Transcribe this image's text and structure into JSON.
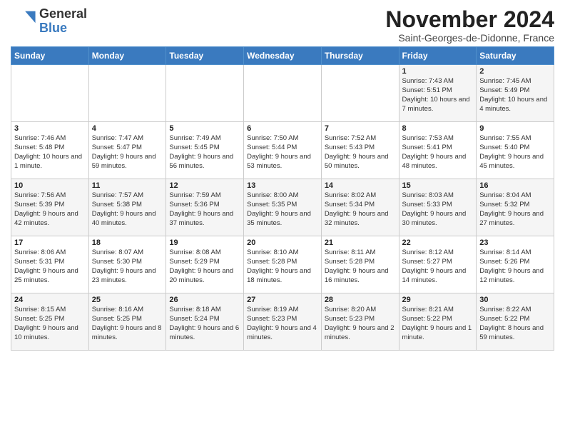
{
  "logo": {
    "line1": "General",
    "line2": "Blue"
  },
  "title": "November 2024",
  "subtitle": "Saint-Georges-de-Didonne, France",
  "weekdays": [
    "Sunday",
    "Monday",
    "Tuesday",
    "Wednesday",
    "Thursday",
    "Friday",
    "Saturday"
  ],
  "weeks": [
    [
      {
        "day": "",
        "info": ""
      },
      {
        "day": "",
        "info": ""
      },
      {
        "day": "",
        "info": ""
      },
      {
        "day": "",
        "info": ""
      },
      {
        "day": "",
        "info": ""
      },
      {
        "day": "1",
        "info": "Sunrise: 7:43 AM\nSunset: 5:51 PM\nDaylight: 10 hours and 7 minutes."
      },
      {
        "day": "2",
        "info": "Sunrise: 7:45 AM\nSunset: 5:49 PM\nDaylight: 10 hours and 4 minutes."
      }
    ],
    [
      {
        "day": "3",
        "info": "Sunrise: 7:46 AM\nSunset: 5:48 PM\nDaylight: 10 hours and 1 minute."
      },
      {
        "day": "4",
        "info": "Sunrise: 7:47 AM\nSunset: 5:47 PM\nDaylight: 9 hours and 59 minutes."
      },
      {
        "day": "5",
        "info": "Sunrise: 7:49 AM\nSunset: 5:45 PM\nDaylight: 9 hours and 56 minutes."
      },
      {
        "day": "6",
        "info": "Sunrise: 7:50 AM\nSunset: 5:44 PM\nDaylight: 9 hours and 53 minutes."
      },
      {
        "day": "7",
        "info": "Sunrise: 7:52 AM\nSunset: 5:43 PM\nDaylight: 9 hours and 50 minutes."
      },
      {
        "day": "8",
        "info": "Sunrise: 7:53 AM\nSunset: 5:41 PM\nDaylight: 9 hours and 48 minutes."
      },
      {
        "day": "9",
        "info": "Sunrise: 7:55 AM\nSunset: 5:40 PM\nDaylight: 9 hours and 45 minutes."
      }
    ],
    [
      {
        "day": "10",
        "info": "Sunrise: 7:56 AM\nSunset: 5:39 PM\nDaylight: 9 hours and 42 minutes."
      },
      {
        "day": "11",
        "info": "Sunrise: 7:57 AM\nSunset: 5:38 PM\nDaylight: 9 hours and 40 minutes."
      },
      {
        "day": "12",
        "info": "Sunrise: 7:59 AM\nSunset: 5:36 PM\nDaylight: 9 hours and 37 minutes."
      },
      {
        "day": "13",
        "info": "Sunrise: 8:00 AM\nSunset: 5:35 PM\nDaylight: 9 hours and 35 minutes."
      },
      {
        "day": "14",
        "info": "Sunrise: 8:02 AM\nSunset: 5:34 PM\nDaylight: 9 hours and 32 minutes."
      },
      {
        "day": "15",
        "info": "Sunrise: 8:03 AM\nSunset: 5:33 PM\nDaylight: 9 hours and 30 minutes."
      },
      {
        "day": "16",
        "info": "Sunrise: 8:04 AM\nSunset: 5:32 PM\nDaylight: 9 hours and 27 minutes."
      }
    ],
    [
      {
        "day": "17",
        "info": "Sunrise: 8:06 AM\nSunset: 5:31 PM\nDaylight: 9 hours and 25 minutes."
      },
      {
        "day": "18",
        "info": "Sunrise: 8:07 AM\nSunset: 5:30 PM\nDaylight: 9 hours and 23 minutes."
      },
      {
        "day": "19",
        "info": "Sunrise: 8:08 AM\nSunset: 5:29 PM\nDaylight: 9 hours and 20 minutes."
      },
      {
        "day": "20",
        "info": "Sunrise: 8:10 AM\nSunset: 5:28 PM\nDaylight: 9 hours and 18 minutes."
      },
      {
        "day": "21",
        "info": "Sunrise: 8:11 AM\nSunset: 5:28 PM\nDaylight: 9 hours and 16 minutes."
      },
      {
        "day": "22",
        "info": "Sunrise: 8:12 AM\nSunset: 5:27 PM\nDaylight: 9 hours and 14 minutes."
      },
      {
        "day": "23",
        "info": "Sunrise: 8:14 AM\nSunset: 5:26 PM\nDaylight: 9 hours and 12 minutes."
      }
    ],
    [
      {
        "day": "24",
        "info": "Sunrise: 8:15 AM\nSunset: 5:25 PM\nDaylight: 9 hours and 10 minutes."
      },
      {
        "day": "25",
        "info": "Sunrise: 8:16 AM\nSunset: 5:25 PM\nDaylight: 9 hours and 8 minutes."
      },
      {
        "day": "26",
        "info": "Sunrise: 8:18 AM\nSunset: 5:24 PM\nDaylight: 9 hours and 6 minutes."
      },
      {
        "day": "27",
        "info": "Sunrise: 8:19 AM\nSunset: 5:23 PM\nDaylight: 9 hours and 4 minutes."
      },
      {
        "day": "28",
        "info": "Sunrise: 8:20 AM\nSunset: 5:23 PM\nDaylight: 9 hours and 2 minutes."
      },
      {
        "day": "29",
        "info": "Sunrise: 8:21 AM\nSunset: 5:22 PM\nDaylight: 9 hours and 1 minute."
      },
      {
        "day": "30",
        "info": "Sunrise: 8:22 AM\nSunset: 5:22 PM\nDaylight: 8 hours and 59 minutes."
      }
    ]
  ]
}
